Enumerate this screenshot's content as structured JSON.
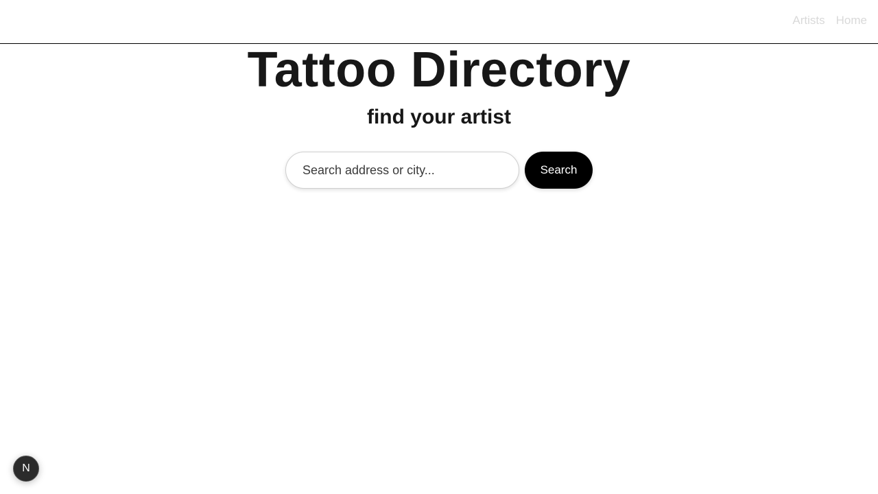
{
  "nav": {
    "items": [
      {
        "label": "Artists"
      },
      {
        "label": "Home"
      }
    ]
  },
  "hero": {
    "title": "Tattoo Directory",
    "subtitle": "find your artist"
  },
  "search": {
    "placeholder": "Search address or city...",
    "value": "",
    "button_label": "Search"
  },
  "badge": {
    "letter": "N",
    "icon": "nextjs-logo-icon"
  },
  "colors": {
    "nav_link": "#d9d9d9",
    "title": "#171717",
    "button_bg": "#000000",
    "button_text": "#ffffff"
  }
}
